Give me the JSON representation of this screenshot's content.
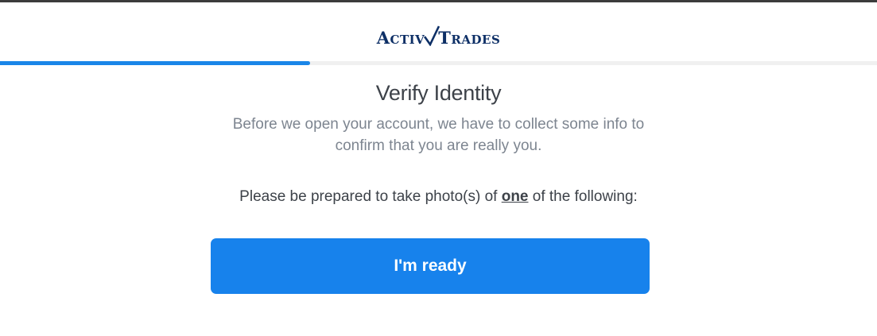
{
  "brand": {
    "logo_part1": "Activ",
    "logo_part2": "Trades",
    "logo_color": "#0d2f66"
  },
  "progress": {
    "fraction": 0.354,
    "fill_color": "#1a86e8",
    "track_color": "#f0f0f0"
  },
  "main": {
    "title": "Verify Identity",
    "subtitle": "Before we open your account, we have to collect some info to confirm that you are really you.",
    "instruction_before": "Please be prepared to take photo(s) of ",
    "instruction_emphasis": "one",
    "instruction_after": " of the following:"
  },
  "actions": {
    "ready_label": "I'm ready",
    "button_color": "#1782ec"
  }
}
